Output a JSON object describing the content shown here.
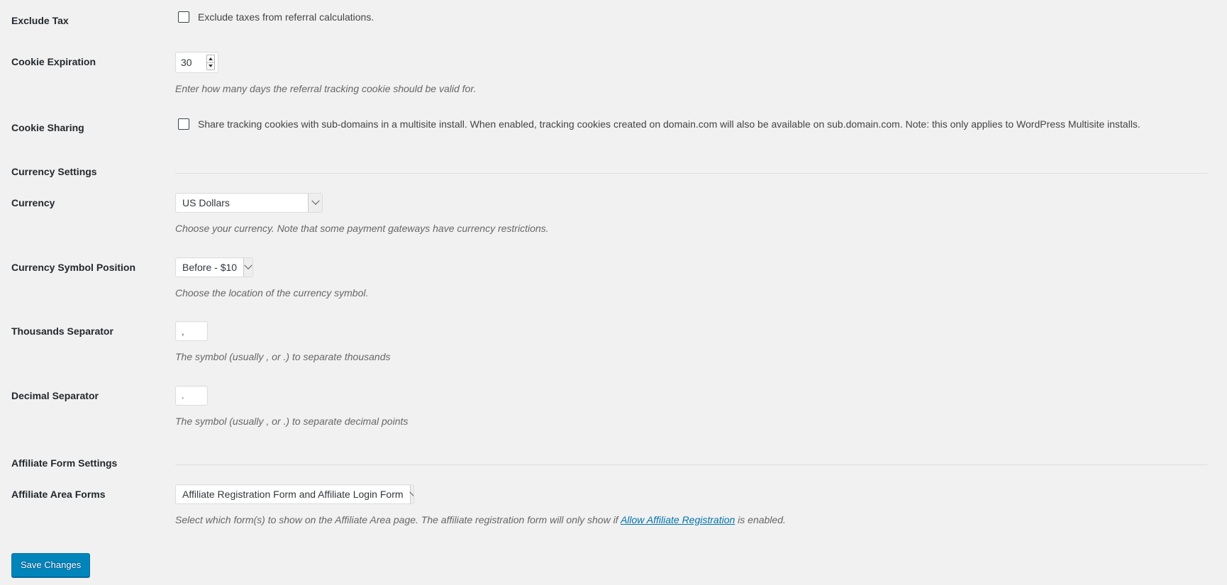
{
  "page": {
    "background_color": "#f1f1f1",
    "accent_color": "#0073aa",
    "button_color": "#0085ba"
  },
  "rows": {
    "exclude_tax": {
      "label": "Exclude Tax",
      "checkbox_label": "Exclude taxes from referral calculations.",
      "checked": false
    },
    "cookie_expiration": {
      "label": "Cookie Expiration",
      "value": "30",
      "description": "Enter how many days the referral tracking cookie should be valid for."
    },
    "cookie_sharing": {
      "label": "Cookie Sharing",
      "checkbox_label": "Share tracking cookies with sub-domains in a multisite install. When enabled, tracking cookies created on domain.com will also be available on sub.domain.com. Note: this only applies to WordPress Multisite installs.",
      "checked": false
    },
    "currency_settings": {
      "label": "Currency Settings"
    },
    "currency": {
      "label": "Currency",
      "selected": "US Dollars",
      "description": "Choose your currency. Note that some payment gateways have currency restrictions."
    },
    "currency_symbol_position": {
      "label": "Currency Symbol Position",
      "selected": "Before - $10",
      "description": "Choose the location of the currency symbol."
    },
    "thousands_separator": {
      "label": "Thousands Separator",
      "value": ",",
      "description": "The symbol (usually , or .) to separate thousands"
    },
    "decimal_separator": {
      "label": "Decimal Separator",
      "value": ".",
      "description": "The symbol (usually , or .) to separate decimal points"
    },
    "affiliate_form_settings": {
      "label": "Affiliate Form Settings"
    },
    "affiliate_area_forms": {
      "label": "Affiliate Area Forms",
      "selected": "Affiliate Registration Form and Affiliate Login Form",
      "description_before": "Select which form(s) to show on the Affiliate Area page. The affiliate registration form will only show if ",
      "description_link": "Allow Affiliate Registration",
      "description_after": " is enabled."
    }
  },
  "submit": {
    "save_label": "Save Changes"
  }
}
